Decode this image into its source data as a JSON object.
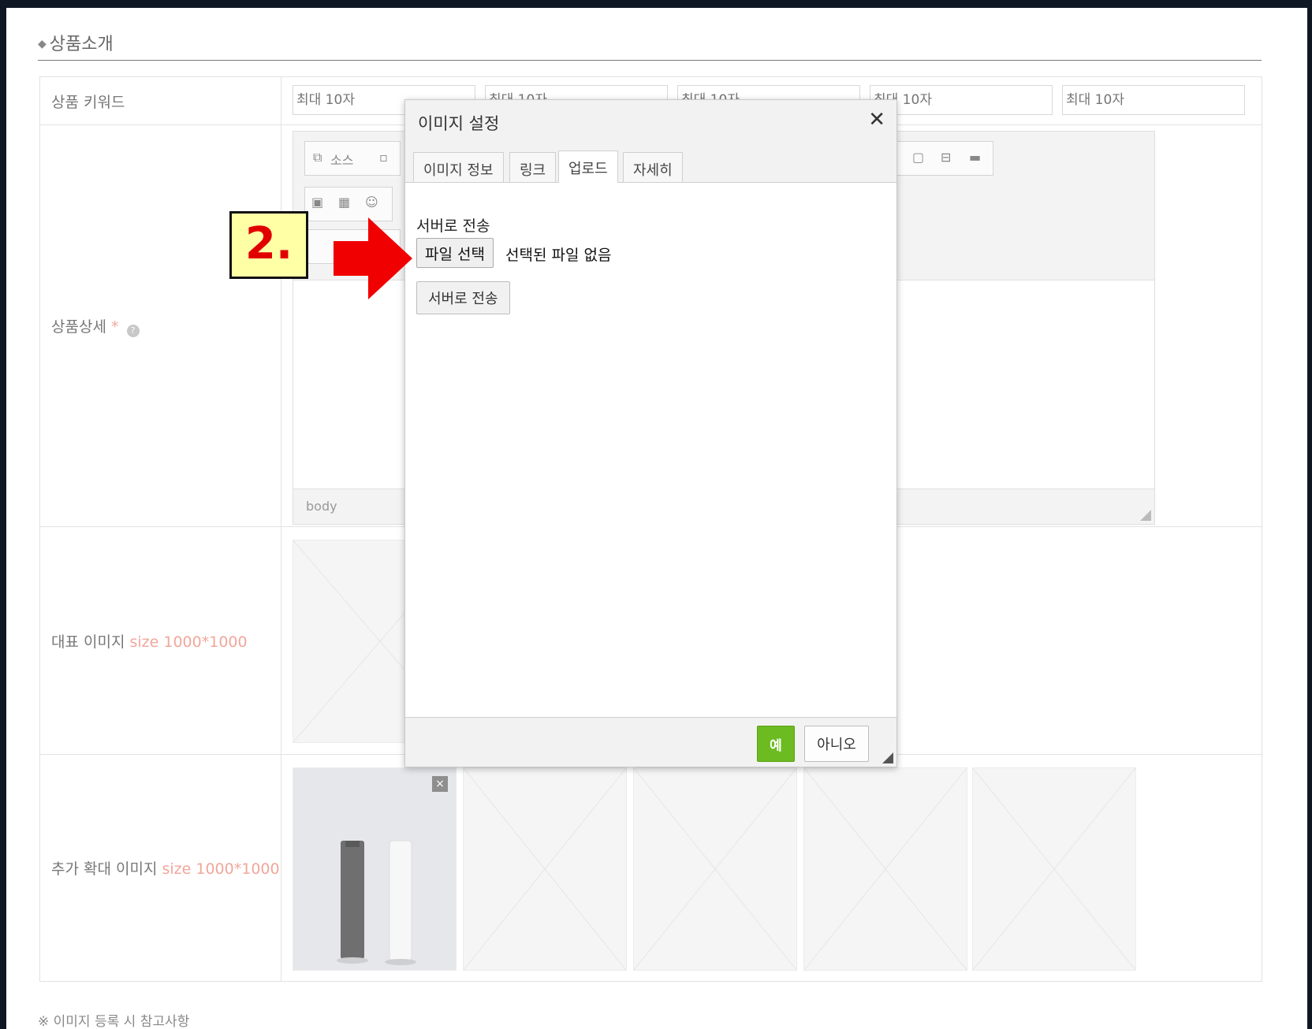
{
  "section": {
    "title": "상품소개"
  },
  "rows": {
    "keyword": {
      "label": "상품 키워드",
      "placeholders": [
        "최대 10자",
        "최대 10자",
        "최대 10자",
        "최대 10자",
        "최대 10자"
      ]
    },
    "detail": {
      "label": "상품상세",
      "required_mark": "*",
      "toolbar_source": "소스",
      "footer_path": "body"
    },
    "main_image": {
      "label": "대표 이미지",
      "size_hint": "size 1000*1000"
    },
    "extra_images": {
      "label": "추가 확대 이미지",
      "size_hint": "size 1000*1000",
      "remove_glyph": "×"
    }
  },
  "note": "※ 이미지 등록 시 참고사항",
  "dialog": {
    "title": "이미지 설정",
    "close_glyph": "✕",
    "tabs": [
      "이미지 정보",
      "링크",
      "업로드",
      "자세히"
    ],
    "active_tab": "업로드",
    "upload_label": "서버로 전송",
    "file_button": "파일 선택",
    "file_none": "선택된 파일 없음",
    "send_button": "서버로 전송",
    "ok_button": "예",
    "cancel_button": "아니오"
  },
  "annotation": {
    "step": "2."
  },
  "colors": {
    "accent": "#f0a79b",
    "ok_green": "#6cbb21",
    "annotation_red": "#e00000",
    "annotation_yellow": "#ffffa6"
  }
}
